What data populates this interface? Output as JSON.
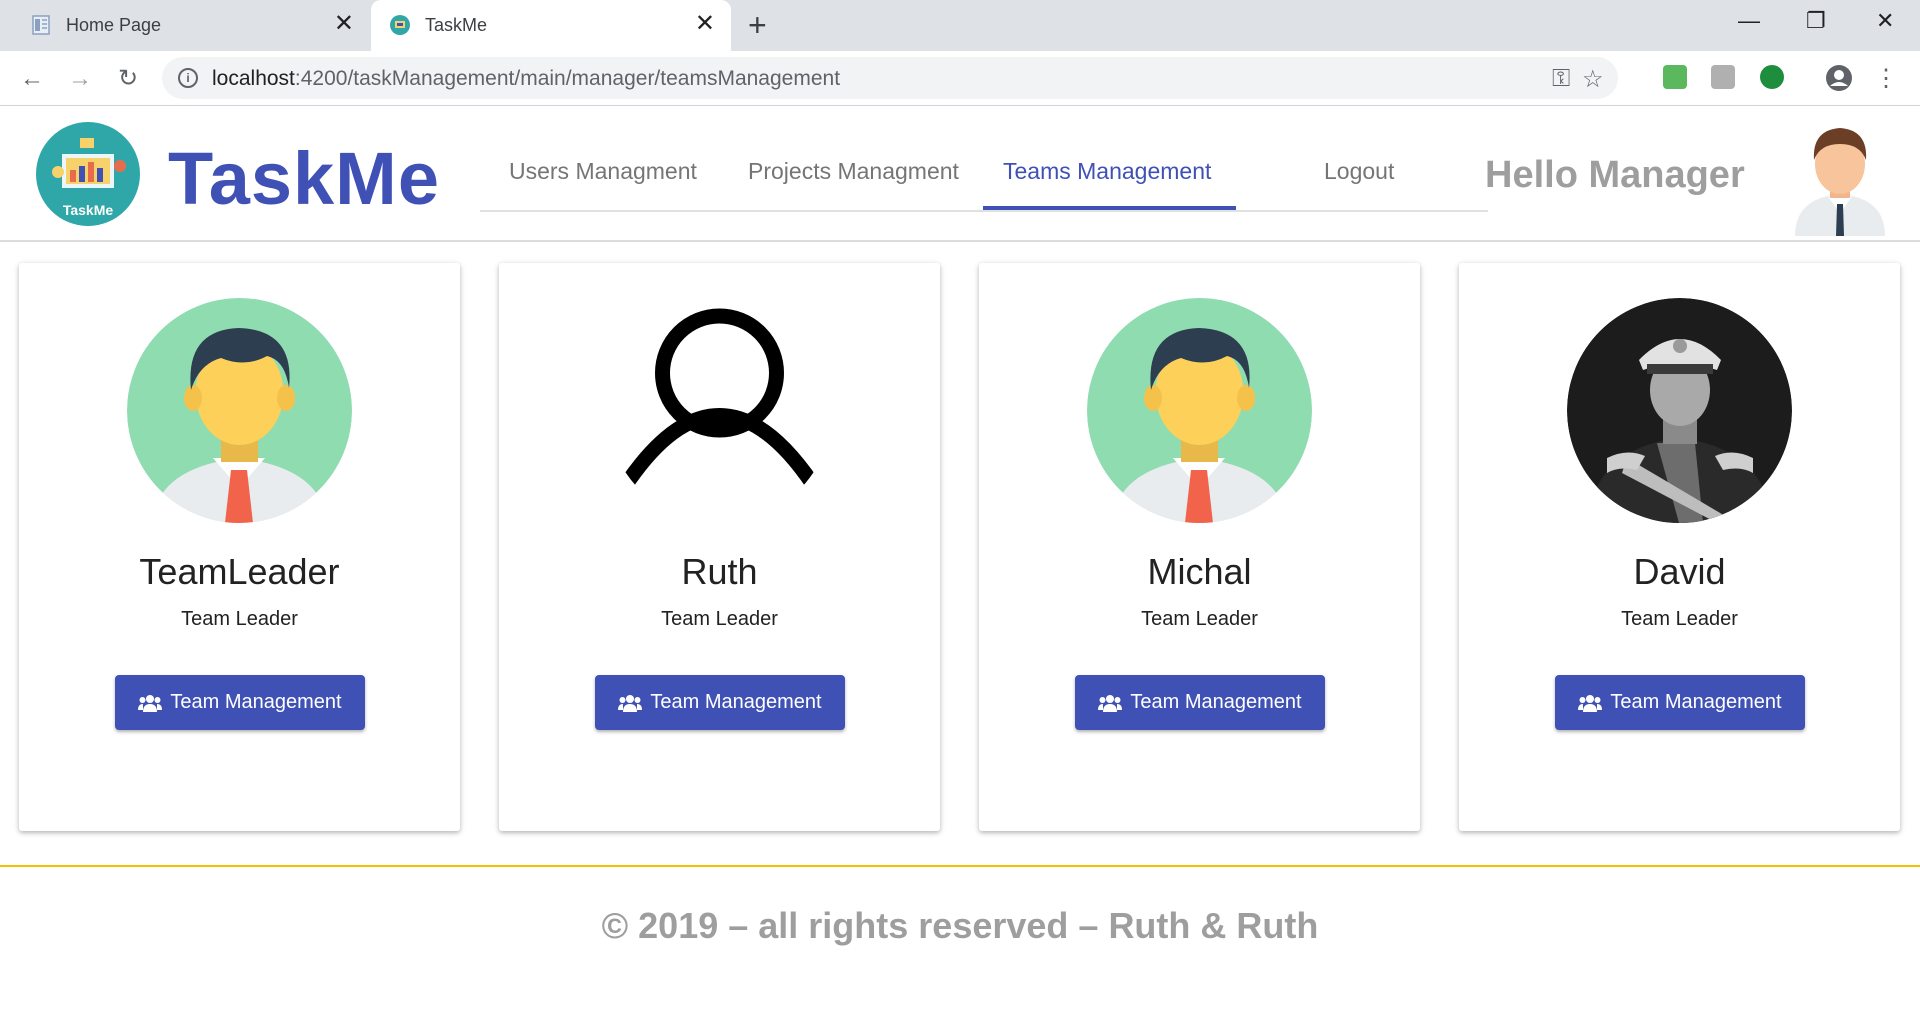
{
  "browser": {
    "tabs": [
      {
        "title": "Home Page",
        "icon": "document-icon",
        "active": false
      },
      {
        "title": "TaskMe",
        "icon": "taskme-favicon-icon",
        "active": true
      }
    ],
    "url_host": "localhost",
    "url_path": ":4200/taskManagement/main/manager/teamsManagement"
  },
  "header": {
    "logo_text": "TaskMe",
    "brand": "TaskMe",
    "nav": [
      {
        "label": "Users Managment",
        "active": false
      },
      {
        "label": "Projects Managment",
        "active": false
      },
      {
        "label": "Teams Management",
        "active": true
      },
      {
        "label": "Logout",
        "active": false
      }
    ],
    "greeting": "Hello Manager"
  },
  "cards": [
    {
      "name": "TeamLeader",
      "role": "Team Leader",
      "button": "Team Management",
      "avatar": "cartoon-man-avatar"
    },
    {
      "name": "Ruth",
      "role": "Team Leader",
      "button": "Team Management",
      "avatar": "person-outline-avatar"
    },
    {
      "name": "Michal",
      "role": "Team Leader",
      "button": "Team Management",
      "avatar": "cartoon-man-avatar"
    },
    {
      "name": "David",
      "role": "Team Leader",
      "button": "Team Management",
      "avatar": "military-portrait-photo"
    }
  ],
  "footer": {
    "text": "© 2019 – all rights reserved – Ruth & Ruth"
  },
  "colors": {
    "primary": "#3f51b5",
    "footer_line": "#f2c200",
    "muted": "#9e9e9e"
  }
}
